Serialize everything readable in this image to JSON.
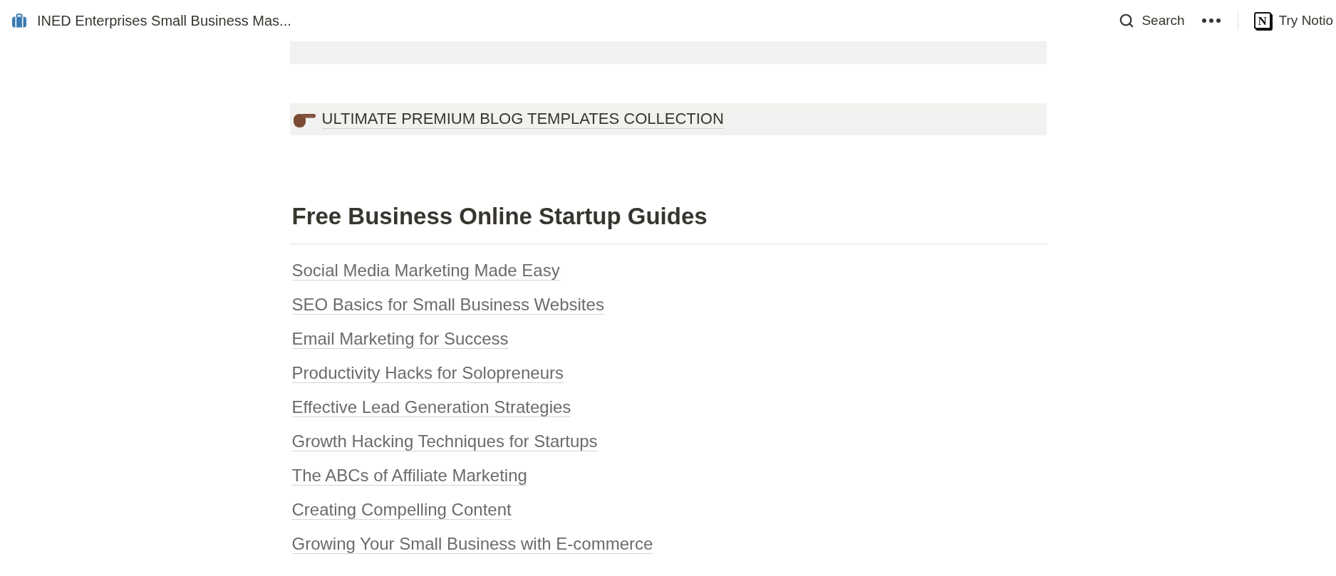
{
  "topbar": {
    "page_title": "INED Enterprises Small Business Mas...",
    "search_label": "Search",
    "logo_letter": "N",
    "try_label": "Try Notio"
  },
  "callouts": [
    {
      "kind": "covered"
    },
    {
      "kind": "link",
      "text": "ULTIMATE PREMIUM BLOG TEMPLATES COLLECTION"
    }
  ],
  "section": {
    "heading": "Free Business Online Startup Guides",
    "links": [
      "Social Media Marketing Made Easy",
      "SEO Basics for Small Business Websites",
      "Email Marketing for Success",
      "Productivity Hacks for Solopreneurs",
      "Effective Lead Generation Strategies",
      "Growth Hacking Techniques for Startups",
      "The ABCs of Affiliate Marketing",
      "Creating Compelling Content",
      "Growing Your Small Business with E-commerce"
    ]
  }
}
